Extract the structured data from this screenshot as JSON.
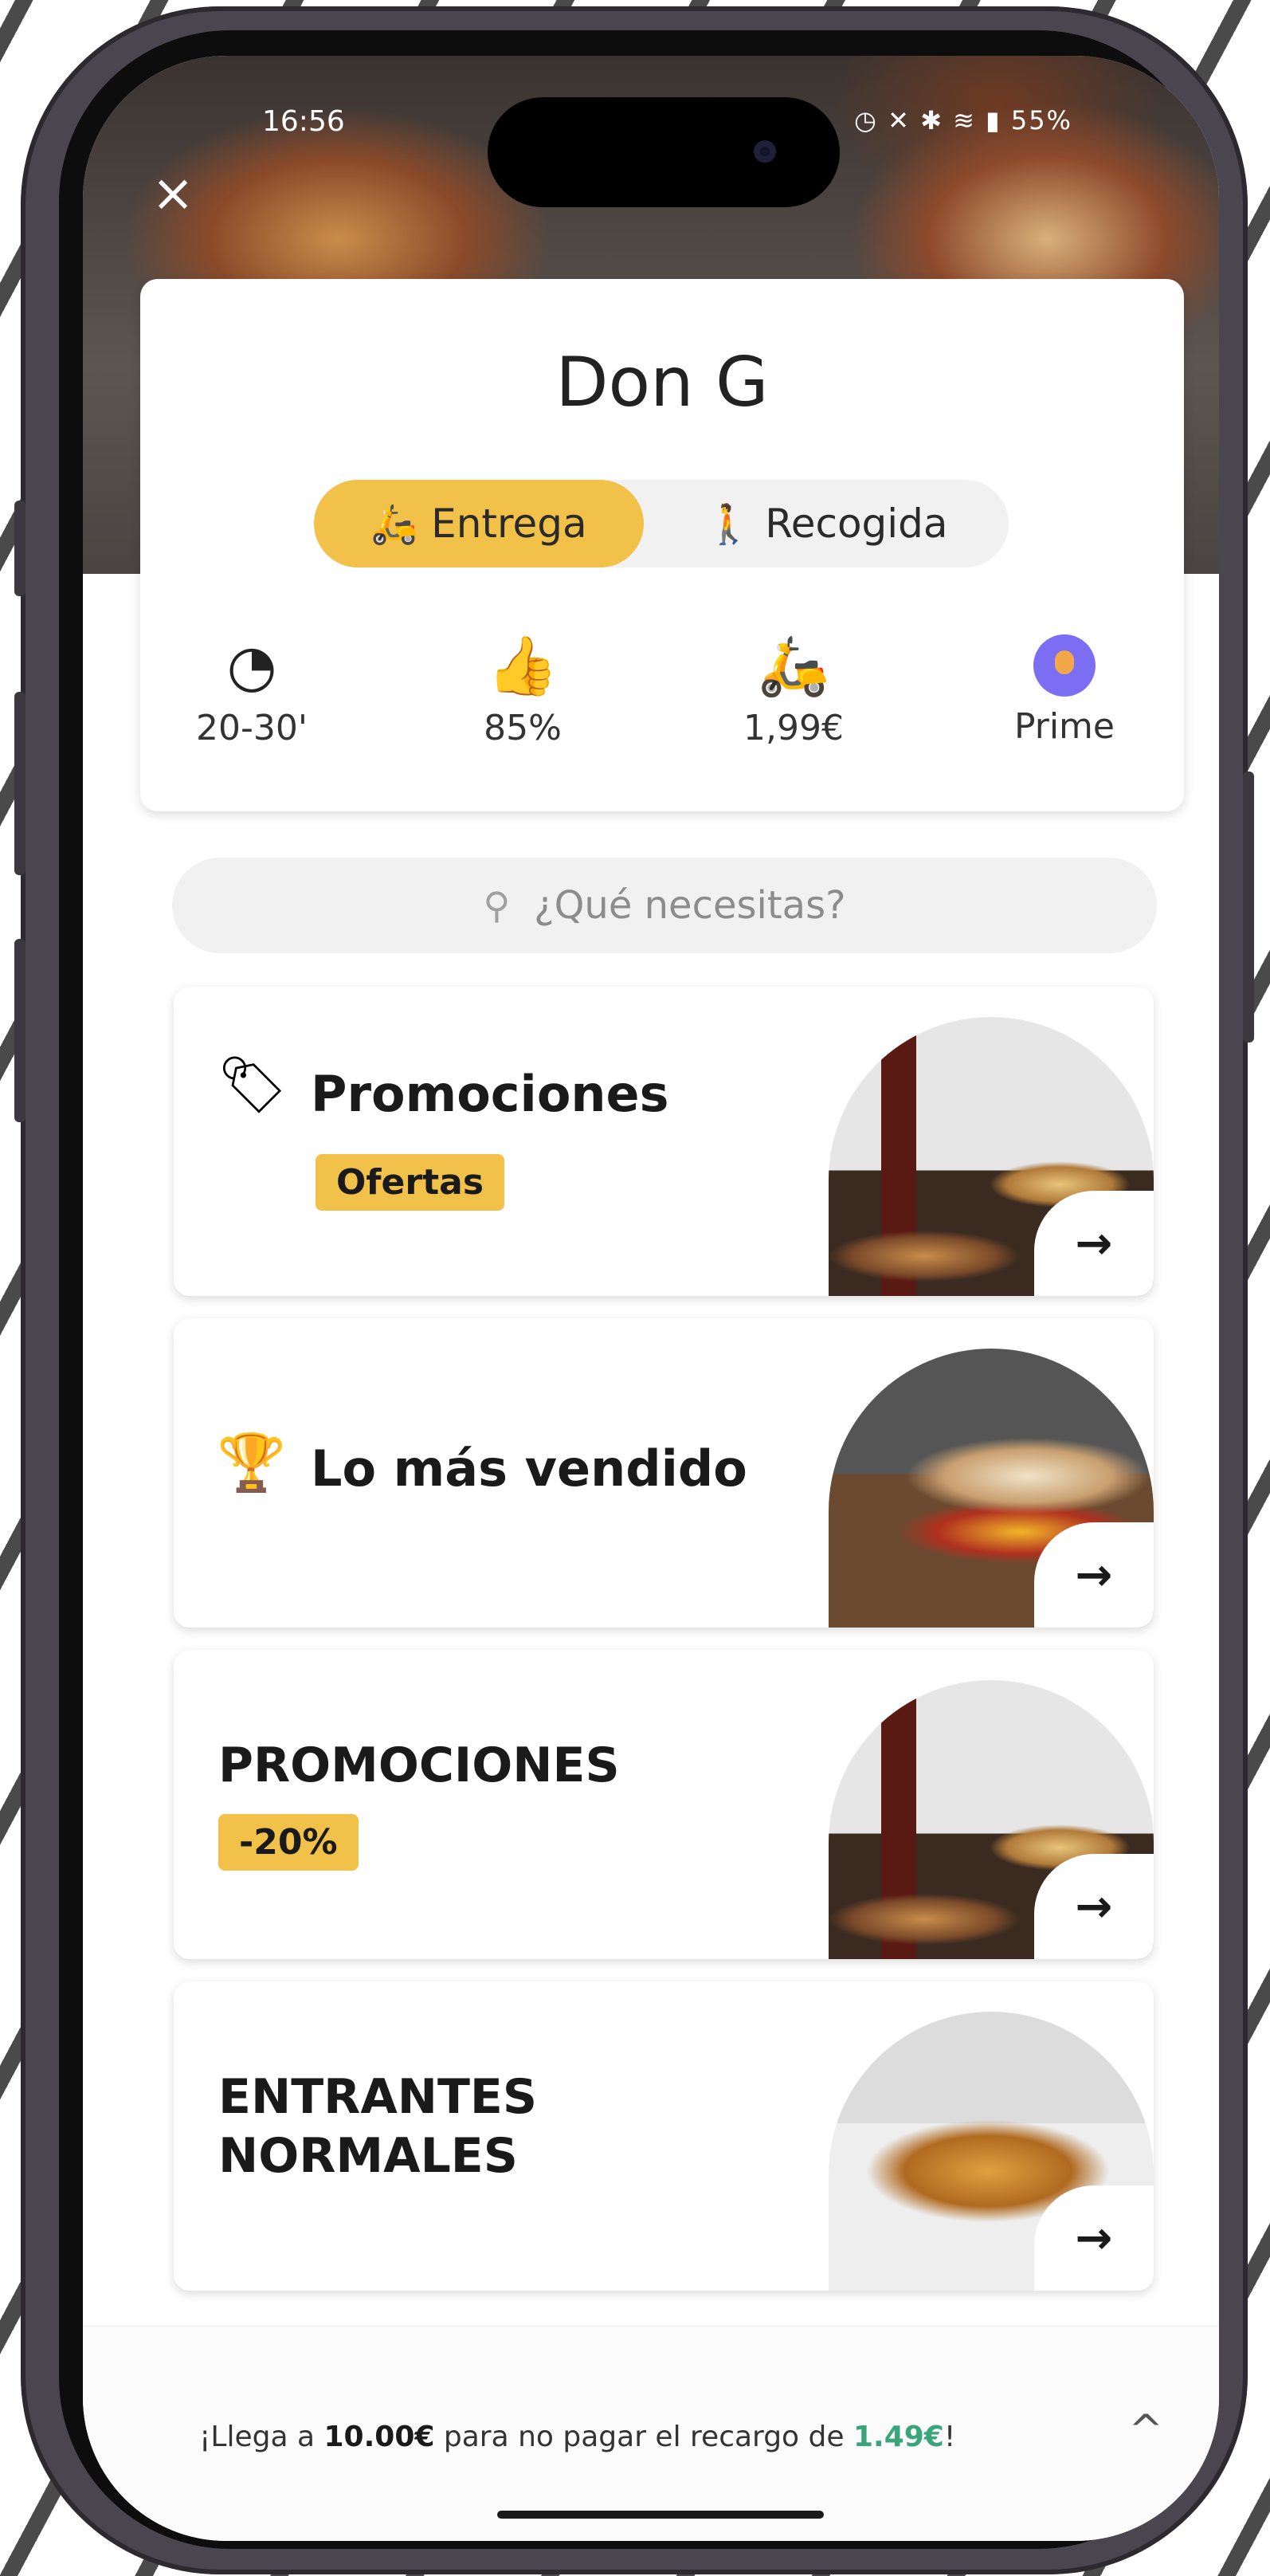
{
  "status_bar": {
    "time": "16:56",
    "battery": "55%"
  },
  "store": {
    "name": "Don G"
  },
  "mode_toggle": {
    "delivery_label": "Entrega",
    "pickup_label": "Recogida"
  },
  "stats": [
    {
      "icon": "clock-icon",
      "value": "20-30'"
    },
    {
      "icon": "thumbs-up-icon",
      "value": "85%"
    },
    {
      "icon": "scooter-icon",
      "value": "1,99€"
    },
    {
      "icon": "prime-badge-icon",
      "value": "Prime"
    }
  ],
  "search": {
    "placeholder": "¿Qué necesitas?"
  },
  "categories": [
    {
      "title": "Promociones",
      "badge": "Ofertas",
      "icon": "tag-percent-icon"
    },
    {
      "title": "Lo más vendido",
      "icon": "trophy-icon"
    },
    {
      "title": "PROMOCIONES",
      "badge": "-20%"
    },
    {
      "title_line1": "ENTRANTES",
      "title_line2": "NORMALES"
    }
  ],
  "bottom_bar": {
    "prefix": "¡Llega a ",
    "amount": "10.00€",
    "middle": " para no pagar el recargo de ",
    "fee": "1.49€",
    "suffix": "!"
  },
  "colors": {
    "accent": "#f2c14a",
    "prime": "#7c6ef2",
    "fee_green": "#3aa57a"
  }
}
